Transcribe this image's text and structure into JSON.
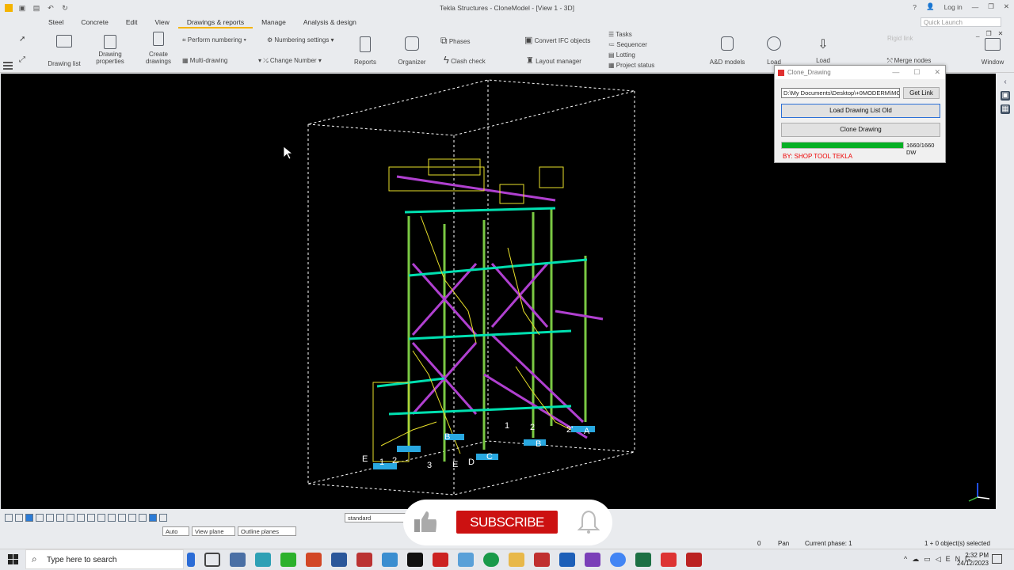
{
  "window": {
    "title": "Tekla Structures - CloneModel  - [View 1 - 3D]"
  },
  "titlebar_right": {
    "help": "?",
    "user": "Log in"
  },
  "menu": [
    "Steel",
    "Concrete",
    "Edit",
    "View",
    "Drawings & reports",
    "Manage",
    "Analysis & design"
  ],
  "quick_launch": {
    "placeholder": "Quick Launch"
  },
  "ribbon": {
    "drawing_list": "Drawing list",
    "drawing_properties_1": "Drawing",
    "drawing_properties_2": "properties",
    "create_drawings_1": "Create",
    "create_drawings_2": "drawings",
    "perform_numbering": "Perform numbering",
    "numbering_settings": "Numbering settings",
    "multi_drawing": "Multi-drawing",
    "change_number": "Change Number",
    "reports": "Reports",
    "organizer": "Organizer",
    "phases": "Phases",
    "clash_check": "Clash check",
    "convert_ifc": "Convert IFC objects",
    "layout_manager": "Layout manager",
    "tasks": "Tasks",
    "sequencer": "Sequencer",
    "lotting": "Lotting",
    "project_status": "Project status",
    "ad_models": "A&D models",
    "load": "Load",
    "load2": "Load",
    "rigid_link": "Rigid link",
    "merge_nodes": "Merge nodes",
    "window": "Window"
  },
  "dialog": {
    "title": "Clone_Drawing",
    "path_value": "D:\\My Documents\\Desktop\\+0MODERM\\MC",
    "get_link": "Get Link",
    "load_list": "Load Drawing List Old",
    "clone": "Clone Drawing",
    "progress_fraction": 1.0,
    "progress_text": "1660/1660 DW",
    "credit": "BY: SHOP TOOL TEKLA"
  },
  "grid_labels": [
    "E",
    "2",
    "1",
    "3",
    "B",
    "C",
    "D",
    "E",
    "1",
    "2",
    "B",
    "2'",
    "A"
  ],
  "statusbar": {
    "filter": "standard",
    "snap_mode": "Auto",
    "plane": "View plane",
    "outline": "Outline planes",
    "count": "0",
    "mode": "Pan",
    "phase": "Current phase: 1",
    "selection": "1 + 0 object(s) selected"
  },
  "overlay": {
    "subscribe": "SUBSCRIBE"
  },
  "taskbar": {
    "search_placeholder": "Type here to search",
    "time": "2:32 PM",
    "date": "24/12/2023"
  },
  "colors": {
    "accent_tab": "#f4b400",
    "progress": "#06b025",
    "subscribe": "#cc1111"
  }
}
